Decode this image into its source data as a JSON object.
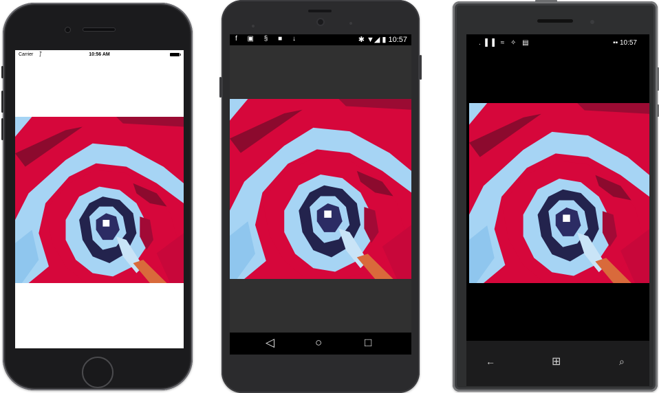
{
  "ios": {
    "carrier": "Carrier",
    "wifi_icon": "⨛",
    "time": "10:56 AM"
  },
  "android": {
    "status_left_icons": "f ▣ § ■ ↓",
    "status_right": "✱ ▼◢ ▮ 10:57",
    "nav_back": "◁",
    "nav_home": "○",
    "nav_recent": "□"
  },
  "windows": {
    "status_left_icons": ".▐▐ ≈ ✧ ▤",
    "status_right": "▪▪ 10:57",
    "nav_back": "←",
    "nav_start": "⊞",
    "nav_search": "⌕"
  },
  "colors": {
    "red": "#d6073b",
    "dark_red": "#8c0a2e",
    "light_blue": "#a6d4f4",
    "navy": "#23234d",
    "orange": "#d96a3b"
  }
}
